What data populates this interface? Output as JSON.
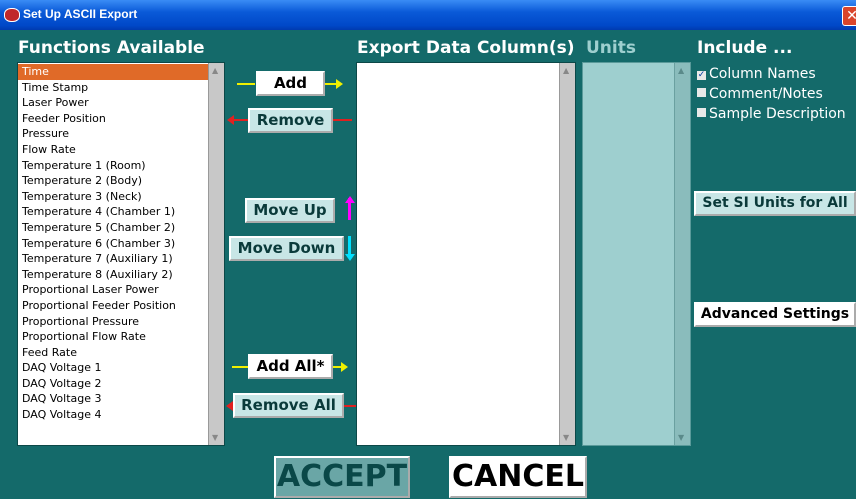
{
  "window": {
    "title": "Set Up ASCII Export",
    "close_glyph": "✕"
  },
  "headings": {
    "functions": "Functions Available",
    "export": "Export Data Column(s)",
    "units": "Units",
    "include": "Include ..."
  },
  "functions_list": [
    "Time",
    "Time Stamp",
    "Laser Power",
    "Feeder Position",
    "Pressure",
    "Flow Rate",
    "Temperature 1 (Room)",
    "Temperature 2 (Body)",
    "Temperature 3 (Neck)",
    "Temperature 4 (Chamber 1)",
    "Temperature 5 (Chamber 2)",
    "Temperature 6 (Chamber 3)",
    "Temperature 7 (Auxiliary 1)",
    "Temperature 8 (Auxiliary 2)",
    "Proportional Laser Power",
    "Proportional Feeder Position",
    "Proportional Pressure",
    "Proportional Flow Rate",
    "Feed Rate",
    "DAQ Voltage 1",
    "DAQ Voltage 2",
    "DAQ Voltage 3",
    "DAQ Voltage 4"
  ],
  "selected_function": "Time",
  "buttons": {
    "add": "Add",
    "remove": "Remove",
    "move_up": "Move Up",
    "move_down": "Move Down",
    "add_all": "Add All*",
    "remove_all": "Remove All",
    "set_si": "Set SI Units for All",
    "advanced": "Advanced Settings",
    "accept": "ACCEPT",
    "cancel": "CANCEL"
  },
  "include": [
    {
      "label": "Column Names",
      "checked": true
    },
    {
      "label": "Comment/Notes",
      "checked": false
    },
    {
      "label": "Sample Description",
      "checked": false
    }
  ],
  "colors": {
    "background": "#146a6a",
    "selection": "#e06a28",
    "arrow_yellow": "#f0f000",
    "arrow_red": "#e02020",
    "arrow_magenta": "#ff00ff",
    "arrow_cyan": "#00e0ff"
  }
}
